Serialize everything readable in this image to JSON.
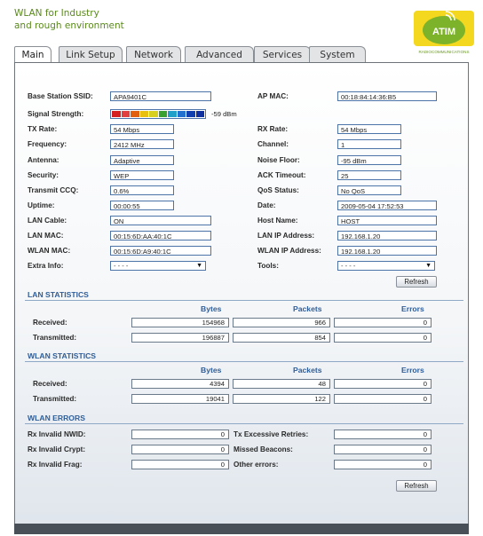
{
  "brand": {
    "line1": "WLAN for Industry",
    "line2": "and rough environment"
  },
  "logo": {
    "name": "ATIM",
    "tagline": "RADIOCOMMUNICATIONS",
    "color": "#7cb32a"
  },
  "tabs": [
    "Main",
    "Link Setup",
    "Network",
    "Advanced",
    "Services",
    "System"
  ],
  "info": {
    "ssid_label": "Base Station SSID:",
    "ssid": "APA9401C",
    "apmac_label": "AP MAC:",
    "apmac": "00:18:84:14:36:B5",
    "signal_label": "Signal Strength:",
    "signal_value": "-59 dBm",
    "signal_colors": [
      "#d42020",
      "#e04040",
      "#e06010",
      "#e8c010",
      "#d8d020",
      "#3aa030",
      "#20a0c8",
      "#2070d0",
      "#1040b0",
      "#1030a0"
    ],
    "txrate_label": "TX Rate:",
    "txrate": "54 Mbps",
    "rxrate_label": "RX Rate:",
    "rxrate": "54 Mbps",
    "freq_label": "Frequency:",
    "freq": "2412 MHz",
    "channel_label": "Channel:",
    "channel": "1",
    "antenna_label": "Antenna:",
    "antenna": "Adaptive",
    "noise_label": "Noise Floor:",
    "noise": "-95 dBm",
    "security_label": "Security:",
    "security": "WEP",
    "ack_label": "ACK Timeout:",
    "ack": "25",
    "ccq_label": "Transmit CCQ:",
    "ccq": "0.6%",
    "qos_label": "QoS Status:",
    "qos": "No QoS",
    "uptime_label": "Uptime:",
    "uptime": "00:00:55",
    "date_label": "Date:",
    "date": "2009-05-04 17:52:53",
    "lancable_label": "LAN Cable:",
    "lancable": "ON",
    "hostname_label": "Host Name:",
    "hostname": "HOST",
    "lanmac_label": "LAN MAC:",
    "lanmac": "00:15:6D:AA:40:1C",
    "lanip_label": "LAN IP Address:",
    "lanip": "192.168.1.20",
    "wlanmac_label": "WLAN MAC:",
    "wlanmac": "00:15:6D:A9:40:1C",
    "wlanip_label": "WLAN IP Address:",
    "wlanip": "192.168.1.20",
    "extra_label": "Extra Info:",
    "extra": "- - - -",
    "tools_label": "Tools:",
    "tools": "- - - -"
  },
  "refresh_label": "Refresh",
  "lan": {
    "title": "LAN STATISTICS",
    "col_bytes": "Bytes",
    "col_packets": "Packets",
    "col_errors": "Errors",
    "rx_label": "Received:",
    "rx_bytes": "154968",
    "rx_packets": "966",
    "rx_errors": "0",
    "tx_label": "Transmitted:",
    "tx_bytes": "196887",
    "tx_packets": "854",
    "tx_errors": "0"
  },
  "wlan": {
    "title": "WLAN STATISTICS",
    "col_bytes": "Bytes",
    "col_packets": "Packets",
    "col_errors": "Errors",
    "rx_label": "Received:",
    "rx_bytes": "4394",
    "rx_packets": "48",
    "rx_errors": "0",
    "tx_label": "Transmitted:",
    "tx_bytes": "19041",
    "tx_packets": "122",
    "tx_errors": "0"
  },
  "errors": {
    "title": "WLAN ERRORS",
    "nwid_label": "Rx Invalid NWID:",
    "nwid": "0",
    "crypt_label": "Rx Invalid Crypt:",
    "crypt": "0",
    "frag_label": "Rx Invalid Frag:",
    "frag": "0",
    "retries_label": "Tx Excessive Retries:",
    "retries": "0",
    "beacons_label": "Missed Beacons:",
    "beacons": "0",
    "other_label": "Other errors:",
    "other": "0"
  }
}
